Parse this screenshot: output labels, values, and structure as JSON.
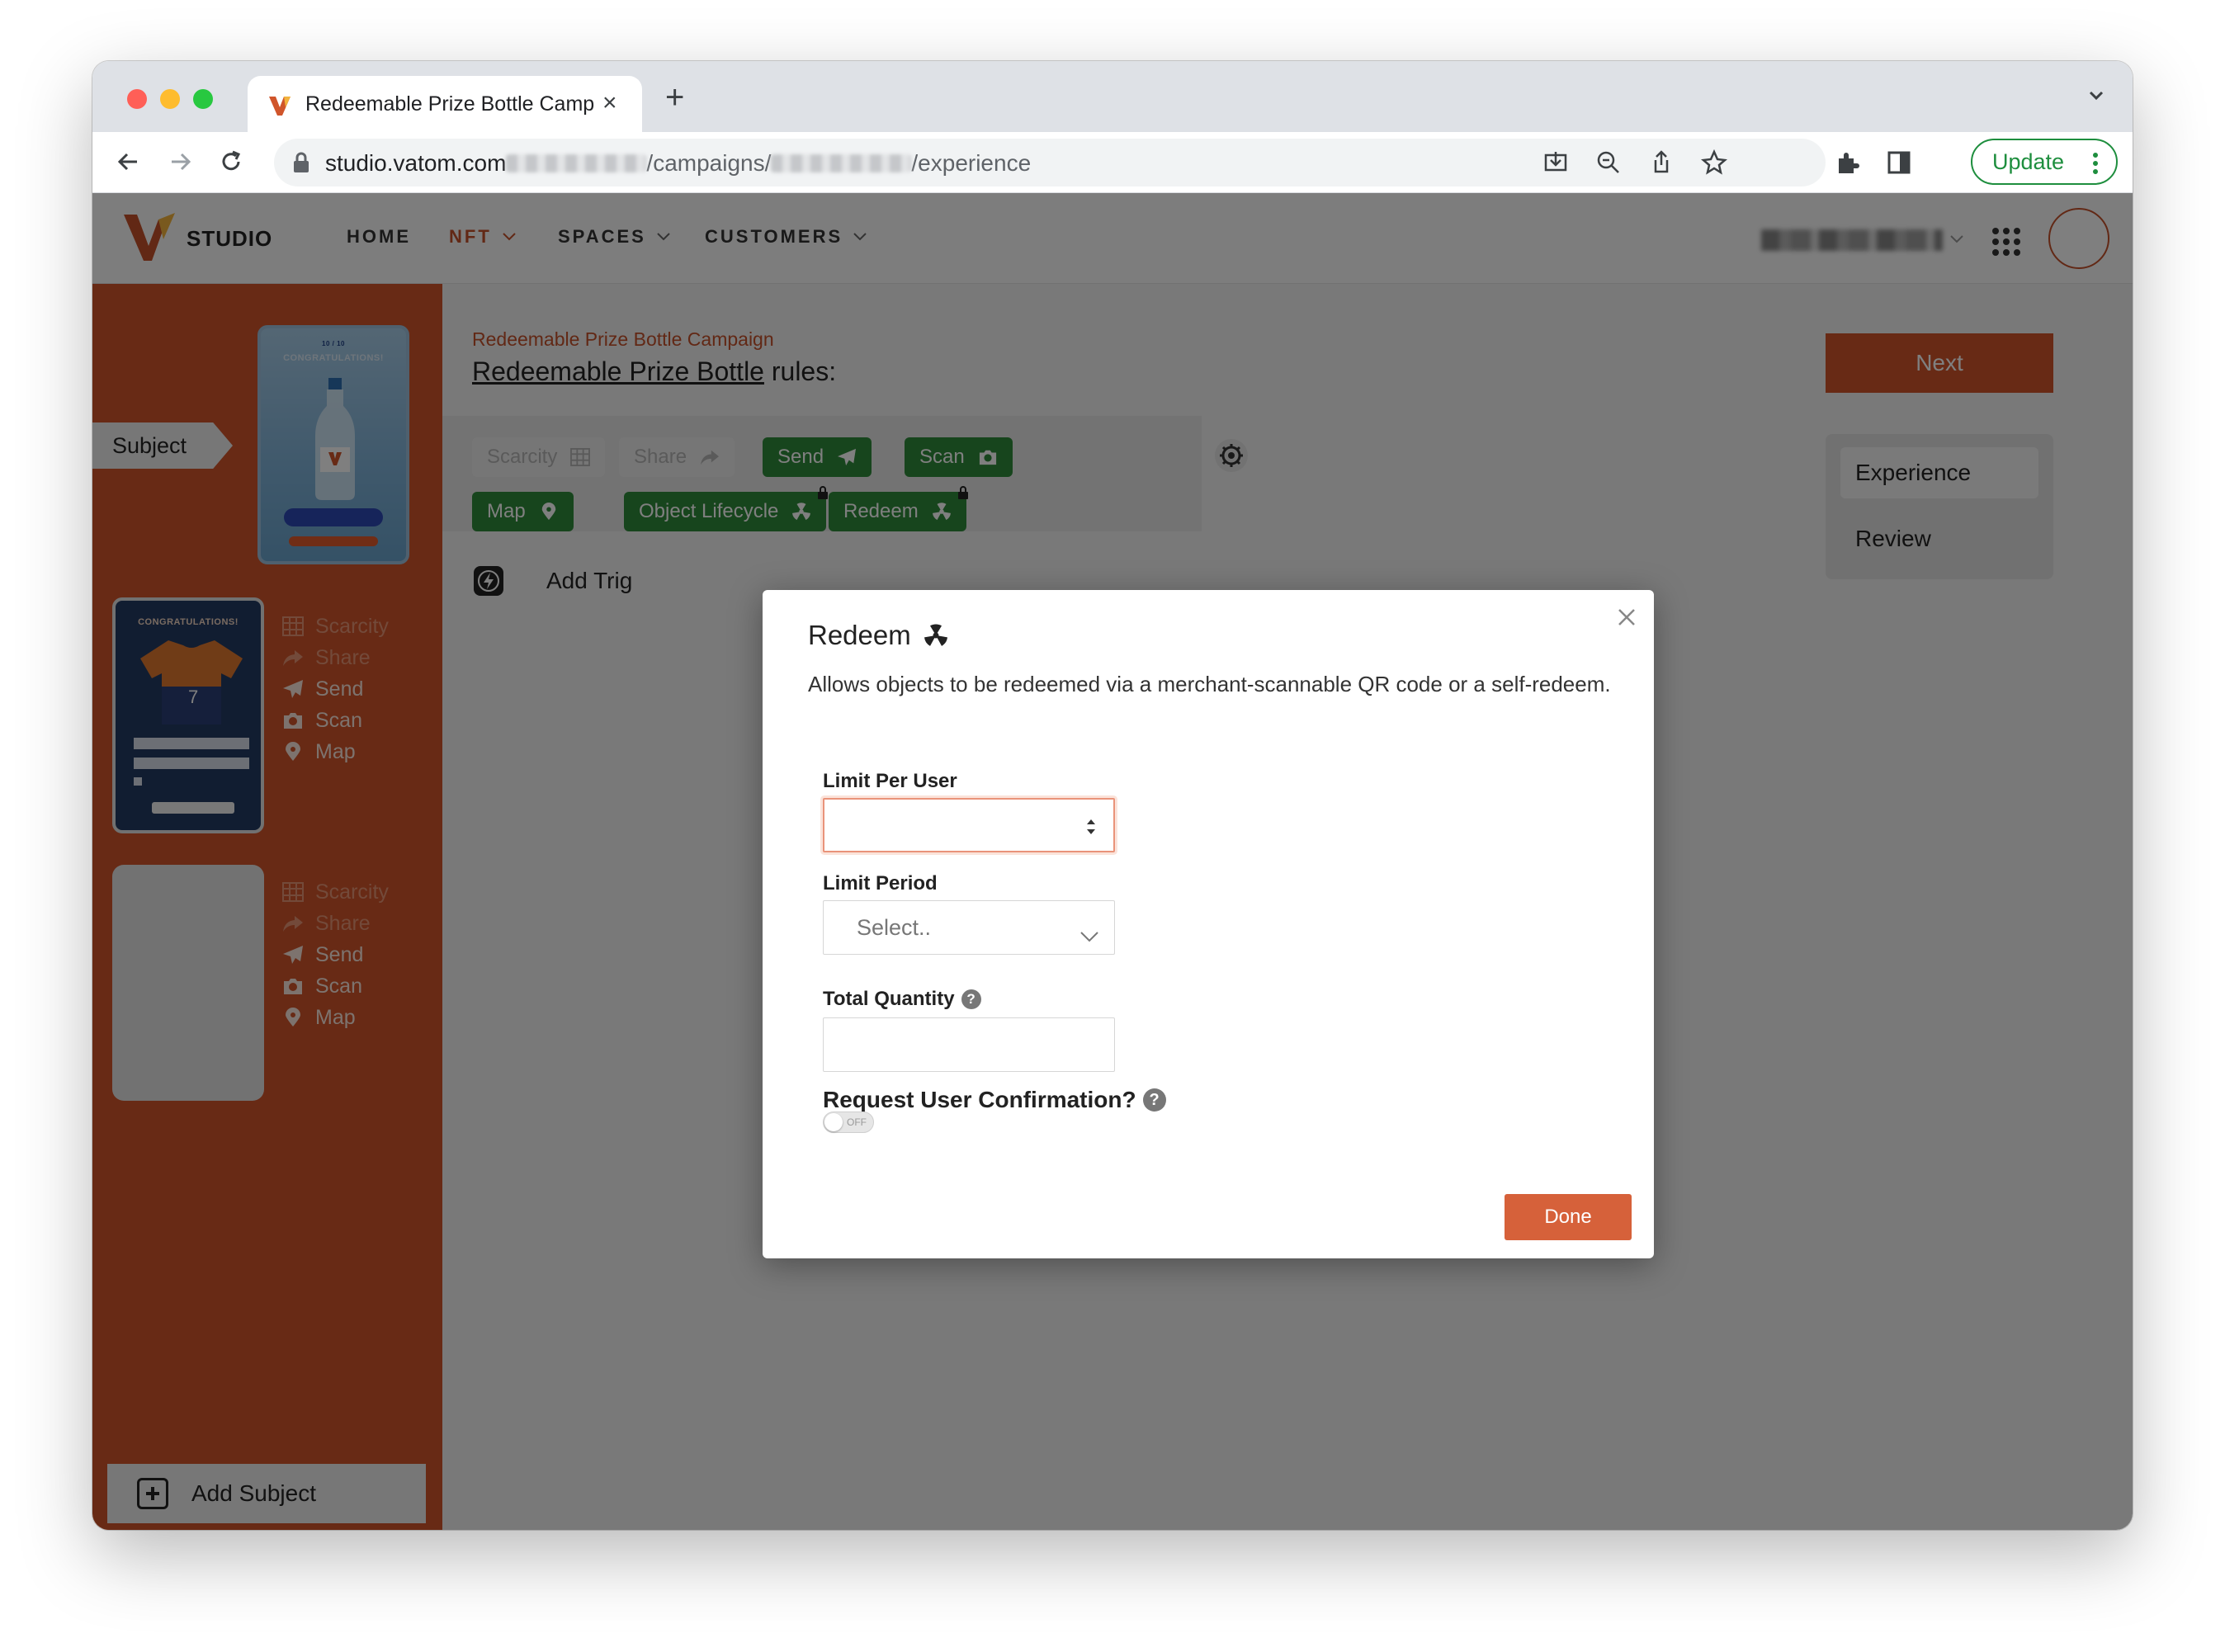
{
  "browser": {
    "tab_title": "Redeemable Prize Bottle Camp",
    "url_prefix": "studio.vatom.com",
    "url_mid": "/campaigns/",
    "url_suffix": "/experience",
    "update_label": "Update"
  },
  "topnav": {
    "logo_text": "STUDIO",
    "items": [
      {
        "label": "HOME"
      },
      {
        "label": "NFT"
      },
      {
        "label": "SPACES"
      },
      {
        "label": "CUSTOMERS"
      }
    ]
  },
  "sidebar": {
    "subject_label": "Subject",
    "bottle_card_text": "CONGRATULATIONS!",
    "jersey_card_text": "CONGRATULATIONS!",
    "rules_a": [
      "Scarcity",
      "Share",
      "Send",
      "Scan",
      "Map"
    ],
    "rules_b": [
      "Scarcity",
      "Share",
      "Send",
      "Scan",
      "Map"
    ],
    "add_subject": "Add Subject"
  },
  "main": {
    "breadcrumb": "Redeemable Prize Bottle Campaign",
    "heading_link": "Redeemable Prize Bottle",
    "heading_rest": " rules:",
    "next_label": "Next",
    "side_items": [
      "Experience",
      "Review"
    ],
    "pills": {
      "scarcity": "Scarcity",
      "share": "Share",
      "send": "Send",
      "scan": "Scan",
      "map": "Map",
      "lifecycle": "Object Lifecycle",
      "redeem": "Redeem"
    },
    "add_trigger": "Add Trig"
  },
  "modal": {
    "title": "Redeem",
    "description": "Allows objects to be redeemed via a merchant-scannable QR code or a self-redeem.",
    "limit_per_user_label": "Limit Per User",
    "limit_per_user_value": "",
    "limit_period_label": "Limit Period",
    "limit_period_placeholder": "Select..",
    "total_quantity_label": "Total Quantity",
    "total_quantity_value": "",
    "confirm_label": "Request User Confirmation?",
    "toggle_text": "OFF",
    "help_glyph": "?",
    "done_label": "Done"
  },
  "colors": {
    "brand": "#d0552b",
    "rule_enabled": "#2f8a3a",
    "done": "#d6613a"
  }
}
